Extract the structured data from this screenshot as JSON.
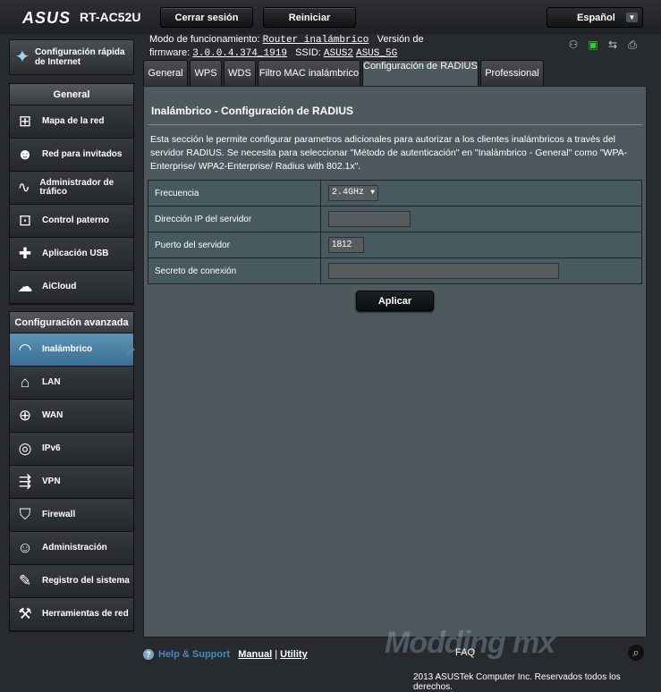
{
  "header": {
    "logo": "ASUS",
    "model": "RT-AC52U",
    "logout": "Cerrar sesión",
    "reboot": "Reiniciar",
    "language": "Español"
  },
  "info": {
    "mode_label": "Modo de funcionamiento:",
    "mode_value": "Router inalámbrico",
    "fw_label": "Versión de firmware:",
    "fw_value": "3.0.0.4.374_1919",
    "ssid_label": "SSID:",
    "ssid1": "ASUS2",
    "ssid2": "ASUS_5G"
  },
  "quick_setup": "Configuración rápida de Internet",
  "general": {
    "title": "General",
    "items": [
      "Mapa de la red",
      "Red para invitados",
      "Administrador de tráfico",
      "Control paterno",
      "Aplicación USB",
      "AiCloud"
    ]
  },
  "advanced": {
    "title": "Configuración avanzada",
    "items": [
      "Inalámbrico",
      "LAN",
      "WAN",
      "IPv6",
      "VPN",
      "Firewall",
      "Administración",
      "Registro del sistema",
      "Herramientas de red"
    ]
  },
  "tabs": [
    "General",
    "WPS",
    "WDS",
    "Filtro MAC inalámbrico",
    "Configuración de RADIUS",
    "Professional"
  ],
  "panel": {
    "title": "Inalámbrico - Configuración de RADIUS",
    "description": "Esta sección le permite configurar parametros adicionales para autorizar a los clientes inalámbricos a través del servidor RADIUS. Se necesita para seleccionar \"Método de autenticación\" en \"Inalámbrico - General\" como \"WPA-Enterprise/ WPA2-Enterprise/ Radius with 802.1x\".",
    "rows": [
      {
        "label": "Frecuencia",
        "value": "2.4GHz"
      },
      {
        "label": "Dirección IP del servidor",
        "value": ""
      },
      {
        "label": "Puerto del servidor",
        "value": "1812"
      },
      {
        "label": "Secreto de conexión",
        "value": ""
      }
    ],
    "apply": "Aplicar"
  },
  "footer": {
    "help": "Help & Support",
    "manual": "Manual",
    "sep": "|",
    "utility": "Utility",
    "faq": "FAQ",
    "copyright": "2013 ASUSTek Computer Inc. Reservados todos los derechos."
  },
  "watermark": "Modding mx",
  "colors": {
    "panel": "#4d595d",
    "active": "#4d86ab",
    "help": "#3f8bc6"
  }
}
